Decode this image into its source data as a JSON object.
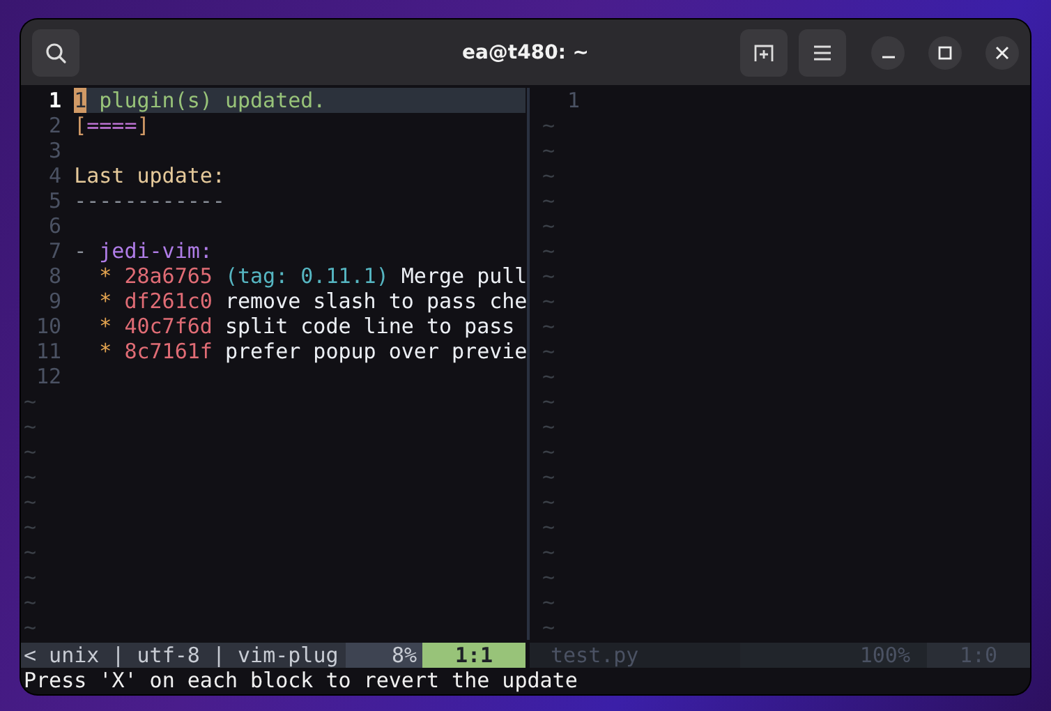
{
  "window": {
    "title": "ea@t480: ~"
  },
  "left_pane": {
    "lines": [
      {
        "number": "1",
        "current": true,
        "segments": [
          {
            "text": "1",
            "kind": "cursor"
          },
          {
            "text": " plugin(s) updated.",
            "kind": "success"
          }
        ]
      },
      {
        "number": "2",
        "current": false,
        "segments": [
          {
            "text": "[",
            "kind": "bracket"
          },
          {
            "text": "====",
            "kind": "progress"
          },
          {
            "text": "]",
            "kind": "bracket"
          }
        ]
      },
      {
        "number": "3",
        "current": false
      },
      {
        "number": "4",
        "current": false,
        "segments": [
          {
            "text": "Last update:",
            "kind": "heading"
          }
        ]
      },
      {
        "number": "5",
        "current": false,
        "segments": [
          {
            "text": "------------",
            "kind": "rule"
          }
        ]
      },
      {
        "number": "6",
        "current": false
      },
      {
        "number": "7",
        "current": false,
        "segments": [
          {
            "text": "- ",
            "kind": "rule"
          },
          {
            "text": "jedi-vim:",
            "kind": "plugin"
          }
        ]
      },
      {
        "number": "8",
        "current": false,
        "segments": [
          {
            "text": "  * ",
            "kind": "bullet"
          },
          {
            "text": "28a6765",
            "kind": "hash"
          },
          {
            "text": " (tag: 0.11.1)",
            "kind": "tag"
          },
          {
            "text": " Merge pull",
            "kind": "plain"
          }
        ]
      },
      {
        "number": "9",
        "current": false,
        "segments": [
          {
            "text": "  * ",
            "kind": "bullet"
          },
          {
            "text": "df261c0",
            "kind": "hash"
          },
          {
            "text": " remove slash to pass che",
            "kind": "plain"
          }
        ]
      },
      {
        "number": "10",
        "current": false,
        "segments": [
          {
            "text": "  * ",
            "kind": "bullet"
          },
          {
            "text": "40c7f6d",
            "kind": "hash"
          },
          {
            "text": " split code line to pass",
            "kind": "plain"
          }
        ]
      },
      {
        "number": "11",
        "current": false,
        "segments": [
          {
            "text": "  * ",
            "kind": "bullet"
          },
          {
            "text": "8c7161f",
            "kind": "hash"
          },
          {
            "text": " prefer popup over previe",
            "kind": "plain"
          }
        ]
      },
      {
        "number": "12",
        "current": false
      }
    ],
    "empty_rows": [
      "~",
      "~",
      "~",
      "~",
      "~",
      "~",
      "~",
      "~",
      "~",
      "~"
    ]
  },
  "right_pane": {
    "lines": [
      {
        "number": "1"
      }
    ],
    "empty_rows": [
      "~",
      "~",
      "~",
      "~",
      "~",
      "~",
      "~",
      "~",
      "~",
      "~",
      "~",
      "~",
      "~",
      "~",
      "~",
      "~",
      "~",
      "~",
      "~",
      "~",
      "~"
    ]
  },
  "status_bar": {
    "left": {
      "active": true,
      "items": [
        {
          "text": "< unix | utf-8 | vim-plug",
          "kind": "info"
        },
        {
          "text": "8%",
          "kind": "percent"
        },
        {
          "text": "1:1",
          "kind": "position"
        }
      ]
    },
    "right": {
      "active": false,
      "items": [
        {
          "text": "test.py",
          "kind": "info"
        },
        {
          "text": "100%",
          "kind": "percent"
        },
        {
          "text": "1:0",
          "kind": "position"
        }
      ]
    }
  },
  "message": "Press 'X' on each block to revert the update"
}
